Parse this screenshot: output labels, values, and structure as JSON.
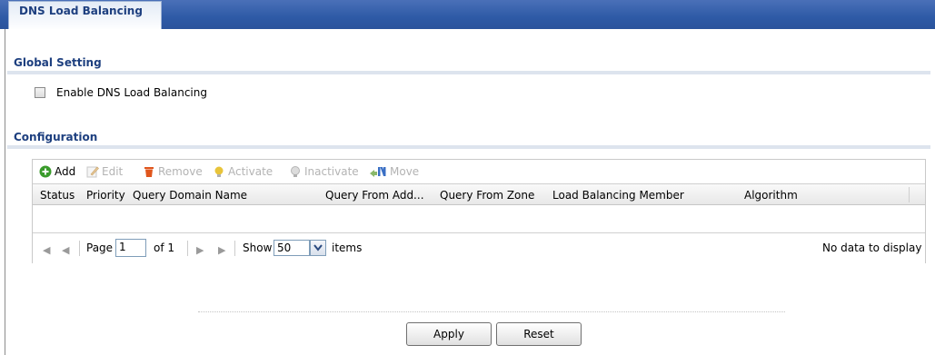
{
  "tab": {
    "label": "DNS Load Balancing"
  },
  "global_setting": {
    "title": "Global Setting",
    "enable_label": "Enable DNS Load Balancing",
    "enabled": false
  },
  "configuration": {
    "title": "Configuration",
    "toolbar": {
      "add": "Add",
      "edit": "Edit",
      "remove": "Remove",
      "activate": "Activate",
      "inactivate": "Inactivate",
      "move": "Move"
    },
    "columns": [
      "Status",
      "Priority",
      "Query Domain Name",
      "Query From Add...",
      "Query From Zone",
      "Load Balancing Member",
      "Algorithm"
    ],
    "rows": [],
    "pager": {
      "page_label": "Page",
      "page_value": "1",
      "of_label": "of 1",
      "show_label": "Show",
      "show_value": "50",
      "items_label": "items",
      "empty_message": "No data to display"
    }
  },
  "buttons": {
    "apply": "Apply",
    "reset": "Reset"
  },
  "colors": {
    "banner": "#2e5aa6",
    "section_title": "#1d3f7f",
    "add_icon": "#3a9b2c",
    "remove_icon": "#e0561d",
    "bulb_icon": "#e8c43a"
  }
}
